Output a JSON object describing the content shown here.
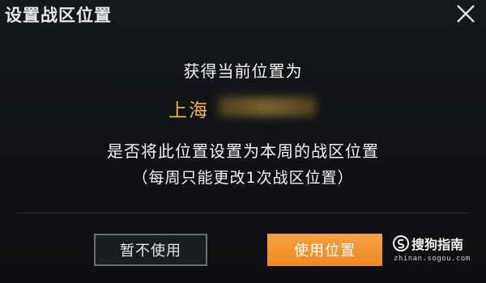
{
  "dialog": {
    "title": "设置战区位置",
    "message_line1": "获得当前位置为",
    "location": "上海",
    "message_line3": "是否将此位置设置为本周的战区位置",
    "message_line4": "（每周只能更改1次战区位置）",
    "cancel_label": "暂不使用",
    "confirm_label": "使用位置"
  },
  "watermark": {
    "brand": "搜狗指南",
    "url": "zhinan.sogou.com"
  },
  "colors": {
    "accent_orange": "#ec8a25",
    "location_gold": "#e9b54a",
    "background": "#0d0f12"
  },
  "icons": {
    "close": "close-icon",
    "watermark_logo": "sogou-logo-icon"
  }
}
